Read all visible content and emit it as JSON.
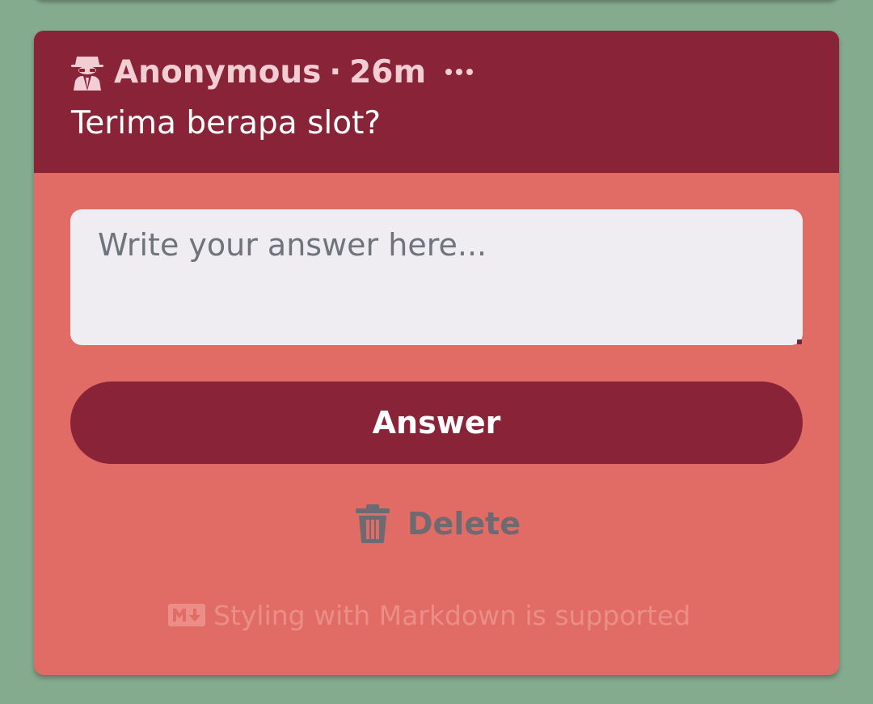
{
  "post": {
    "author": "Anonymous",
    "separator": "·",
    "time": "26m",
    "question": "Terima berapa slot?"
  },
  "icons": {
    "author": "spy-icon",
    "more": "more-horizontal-icon",
    "delete": "trash-icon",
    "markdown": "markdown-icon"
  },
  "answer": {
    "placeholder": "Write your answer here...",
    "value": "",
    "submit_label": "Answer"
  },
  "actions": {
    "delete_label": "Delete"
  },
  "footer": {
    "markdown_note": "Styling with Markdown is supported"
  },
  "colors": {
    "page_background": "#85ab8f",
    "card_background": "#e16b65",
    "header_background": "#892338",
    "button_background": "#892338",
    "textarea_background": "#efedf2"
  }
}
